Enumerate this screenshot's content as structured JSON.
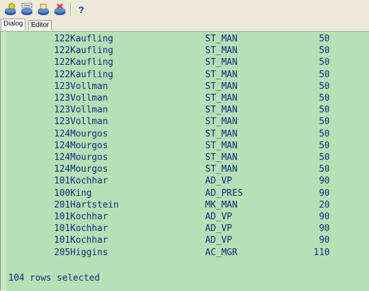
{
  "toolbar": {
    "icons": [
      "run-script-icon",
      "run-command-icon",
      "load-script-icon",
      "clear-icon",
      "help-icon"
    ],
    "help_label": "?"
  },
  "tabs": [
    {
      "label": "Dialog",
      "active": true
    },
    {
      "label": "Editor",
      "active": false
    }
  ],
  "rows": [
    {
      "id": "122",
      "name": "Kaufling",
      "job": "ST_MAN",
      "value": "50"
    },
    {
      "id": "122",
      "name": "Kaufling",
      "job": "ST_MAN",
      "value": "50"
    },
    {
      "id": "122",
      "name": "Kaufling",
      "job": "ST_MAN",
      "value": "50"
    },
    {
      "id": "122",
      "name": "Kaufling",
      "job": "ST_MAN",
      "value": "50"
    },
    {
      "id": "123",
      "name": "Vollman",
      "job": "ST_MAN",
      "value": "50"
    },
    {
      "id": "123",
      "name": "Vollman",
      "job": "ST_MAN",
      "value": "50"
    },
    {
      "id": "123",
      "name": "Vollman",
      "job": "ST_MAN",
      "value": "50"
    },
    {
      "id": "123",
      "name": "Vollman",
      "job": "ST_MAN",
      "value": "50"
    },
    {
      "id": "124",
      "name": "Mourgos",
      "job": "ST_MAN",
      "value": "50"
    },
    {
      "id": "124",
      "name": "Mourgos",
      "job": "ST_MAN",
      "value": "50"
    },
    {
      "id": "124",
      "name": "Mourgos",
      "job": "ST_MAN",
      "value": "50"
    },
    {
      "id": "124",
      "name": "Mourgos",
      "job": "ST_MAN",
      "value": "50"
    },
    {
      "id": "101",
      "name": "Kochhar",
      "job": "AD_VP",
      "value": "90"
    },
    {
      "id": "100",
      "name": "King",
      "job": "AD_PRES",
      "value": "90"
    },
    {
      "id": "201",
      "name": "Hartstein",
      "job": "MK_MAN",
      "value": "20"
    },
    {
      "id": "101",
      "name": "Kochhar",
      "job": "AD_VP",
      "value": "90"
    },
    {
      "id": "101",
      "name": "Kochhar",
      "job": "AD_VP",
      "value": "90"
    },
    {
      "id": "101",
      "name": "Kochhar",
      "job": "AD_VP",
      "value": "90"
    },
    {
      "id": "205",
      "name": "Higgins",
      "job": "AC_MGR",
      "value": "110"
    }
  ],
  "footer": "104 rows selected"
}
